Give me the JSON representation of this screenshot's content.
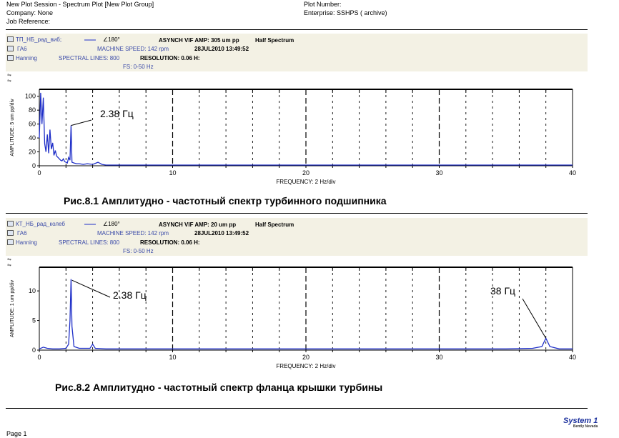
{
  "header": {
    "session": "New Plot Session - Spectrum Plot [New Plot Group]",
    "company": "Company: None",
    "job": "Job Reference:",
    "plot_number": "Plot Number:",
    "enterprise": "Enterprise: SSHPS ( archive)"
  },
  "plots": [
    {
      "info": {
        "channel": "ТП_НБ_рад_виб;",
        "angle": "∠180°",
        "asynch": "ASYNCH VIF AMP: 305 um pp",
        "half": "Half Spectrum",
        "machine": "ГА6",
        "machine_speed": "MACHINE SPEED: 142 rpm",
        "date": "28JUL2010 13:49:52",
        "window": "Hanning",
        "lines": "SPECTRAL LINES: 800",
        "resolution": "RESOLUTION: 0.06 H:",
        "fs": "FS: 0-50 Hz"
      },
      "annotation": "2.38 Гц",
      "caption": "Рис.8.1  Амплитудно - частотный спектр турбинного подшипника"
    },
    {
      "info": {
        "channel": "КТ_НБ_рад_колеб",
        "angle": "∠180°",
        "asynch": "ASYNCH VIF AMP: 20 um pp",
        "half": "Half Spectrum",
        "machine": "ГА6",
        "machine_speed": "MACHINE SPEED: 142 rpm",
        "date": "28JUL2010 13:49:52",
        "window": "Hanning",
        "lines": "SPECTRAL LINES: 800",
        "resolution": "RESOLUTION: 0.06 H:",
        "fs": "FS: 0-50 Hz"
      },
      "annotation": "2.38 Гц",
      "annotation2": "38 Гц",
      "caption": "Рис.8.2  Амплитудно - частотный спектр фланца крышки турбины"
    }
  ],
  "footer": {
    "page": "Page 1",
    "brand": "System 1",
    "brand_sub": "Bently Nevada"
  },
  "colors": {
    "trace": "#1f2fc8",
    "band": "#f3f1e4",
    "axis": "#000000"
  },
  "chart_data": [
    {
      "type": "line",
      "xlabel": "FREQUENCY: 2 Hz/div",
      "ylabel": "AMPLITUDE: 5 um pp/div",
      "xlim": [
        0,
        40
      ],
      "ylim": [
        0,
        110
      ],
      "xticks": [
        0,
        10,
        20,
        30,
        40
      ],
      "yticks": [
        0,
        20,
        40,
        60,
        80,
        100
      ],
      "grid": true,
      "x": [
        0,
        0.1,
        0.2,
        0.3,
        0.4,
        0.5,
        0.6,
        0.7,
        0.8,
        0.9,
        1.0,
        1.1,
        1.2,
        1.3,
        1.4,
        1.5,
        1.6,
        1.7,
        1.8,
        1.9,
        2.0,
        2.1,
        2.2,
        2.3,
        2.38,
        2.45,
        2.6,
        2.8,
        3.0,
        3.3,
        3.6,
        4.0,
        4.4,
        4.7,
        5.0,
        6.0,
        8.0,
        10.0,
        15.0,
        20.0,
        25.0,
        30.0,
        35.0,
        38.0,
        40.0
      ],
      "y": [
        40,
        105,
        60,
        98,
        32,
        20,
        45,
        18,
        52,
        24,
        33,
        15,
        22,
        14,
        12,
        10,
        8,
        7,
        10,
        6,
        5,
        4,
        12,
        8,
        58,
        5,
        4,
        3,
        3,
        2,
        3,
        2,
        5,
        2,
        1,
        1,
        1,
        1,
        1,
        1,
        1,
        1,
        1,
        1,
        1
      ]
    },
    {
      "type": "line",
      "xlabel": "FREQUENCY: 2 Hz/div",
      "ylabel": "AMPLITUDE: 1 um pp/div",
      "xlim": [
        0,
        40
      ],
      "ylim": [
        0,
        14
      ],
      "xticks": [
        0,
        10,
        20,
        30,
        40
      ],
      "yticks": [
        0,
        5,
        10
      ],
      "grid": true,
      "x": [
        0,
        0.3,
        0.6,
        1.0,
        1.5,
        2.0,
        2.2,
        2.3,
        2.38,
        2.45,
        2.6,
        3.0,
        3.8,
        4.0,
        4.2,
        5.0,
        8.0,
        10.0,
        15.0,
        20.0,
        25.0,
        30.0,
        35.0,
        37.0,
        37.7,
        38.0,
        38.3,
        39.0,
        40.0
      ],
      "y": [
        0.2,
        0.5,
        0.3,
        0.2,
        0.2,
        0.3,
        1.0,
        5.0,
        12.0,
        4.0,
        0.6,
        0.3,
        0.3,
        1.0,
        0.3,
        0.2,
        0.2,
        0.2,
        0.2,
        0.2,
        0.2,
        0.2,
        0.2,
        0.3,
        0.6,
        2.0,
        0.6,
        0.2,
        0.2
      ]
    }
  ]
}
